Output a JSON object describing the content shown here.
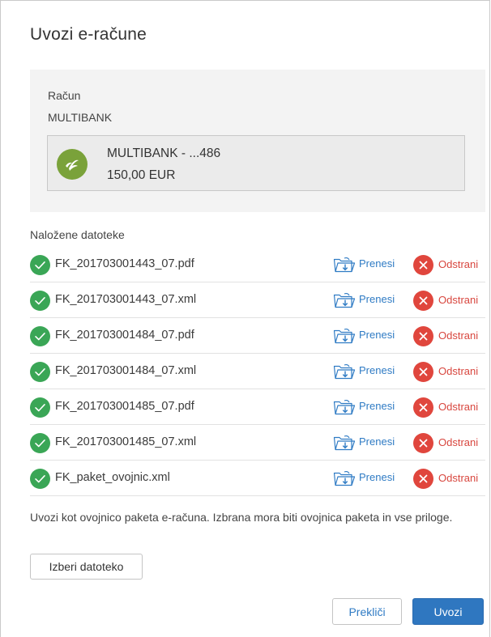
{
  "dialog": {
    "title": "Uvozi e-račune"
  },
  "account": {
    "label": "Račun",
    "name": "MULTIBANK",
    "card_title": "MULTIBANK - ...486",
    "card_amount": "150,00 EUR",
    "logo_icon": "bank-logo-icon",
    "logo_color": "#7aa23a"
  },
  "files": {
    "label": "Naložene datoteke",
    "download_label": "Prenesi",
    "remove_label": "Odstrani",
    "items": [
      {
        "name": "FK_201703001443_07.pdf"
      },
      {
        "name": "FK_201703001443_07.xml"
      },
      {
        "name": "FK_201703001484_07.pdf"
      },
      {
        "name": "FK_201703001484_07.xml"
      },
      {
        "name": "FK_201703001485_07.pdf"
      },
      {
        "name": "FK_201703001485_07.xml"
      },
      {
        "name": "FK_paket_ovojnic.xml"
      }
    ]
  },
  "import": {
    "hint": "Uvozi kot ovojnico paketa e-računa. Izbrana mora biti ovojnica paketa in vse priloge.",
    "choose_file_label": "Izberi datoteko"
  },
  "footer": {
    "cancel_label": "Prekliči",
    "import_label": "Uvozi"
  },
  "colors": {
    "success": "#3aa656",
    "danger": "#e0463d",
    "link": "#2f7bc4",
    "primary": "#2f77c0"
  }
}
